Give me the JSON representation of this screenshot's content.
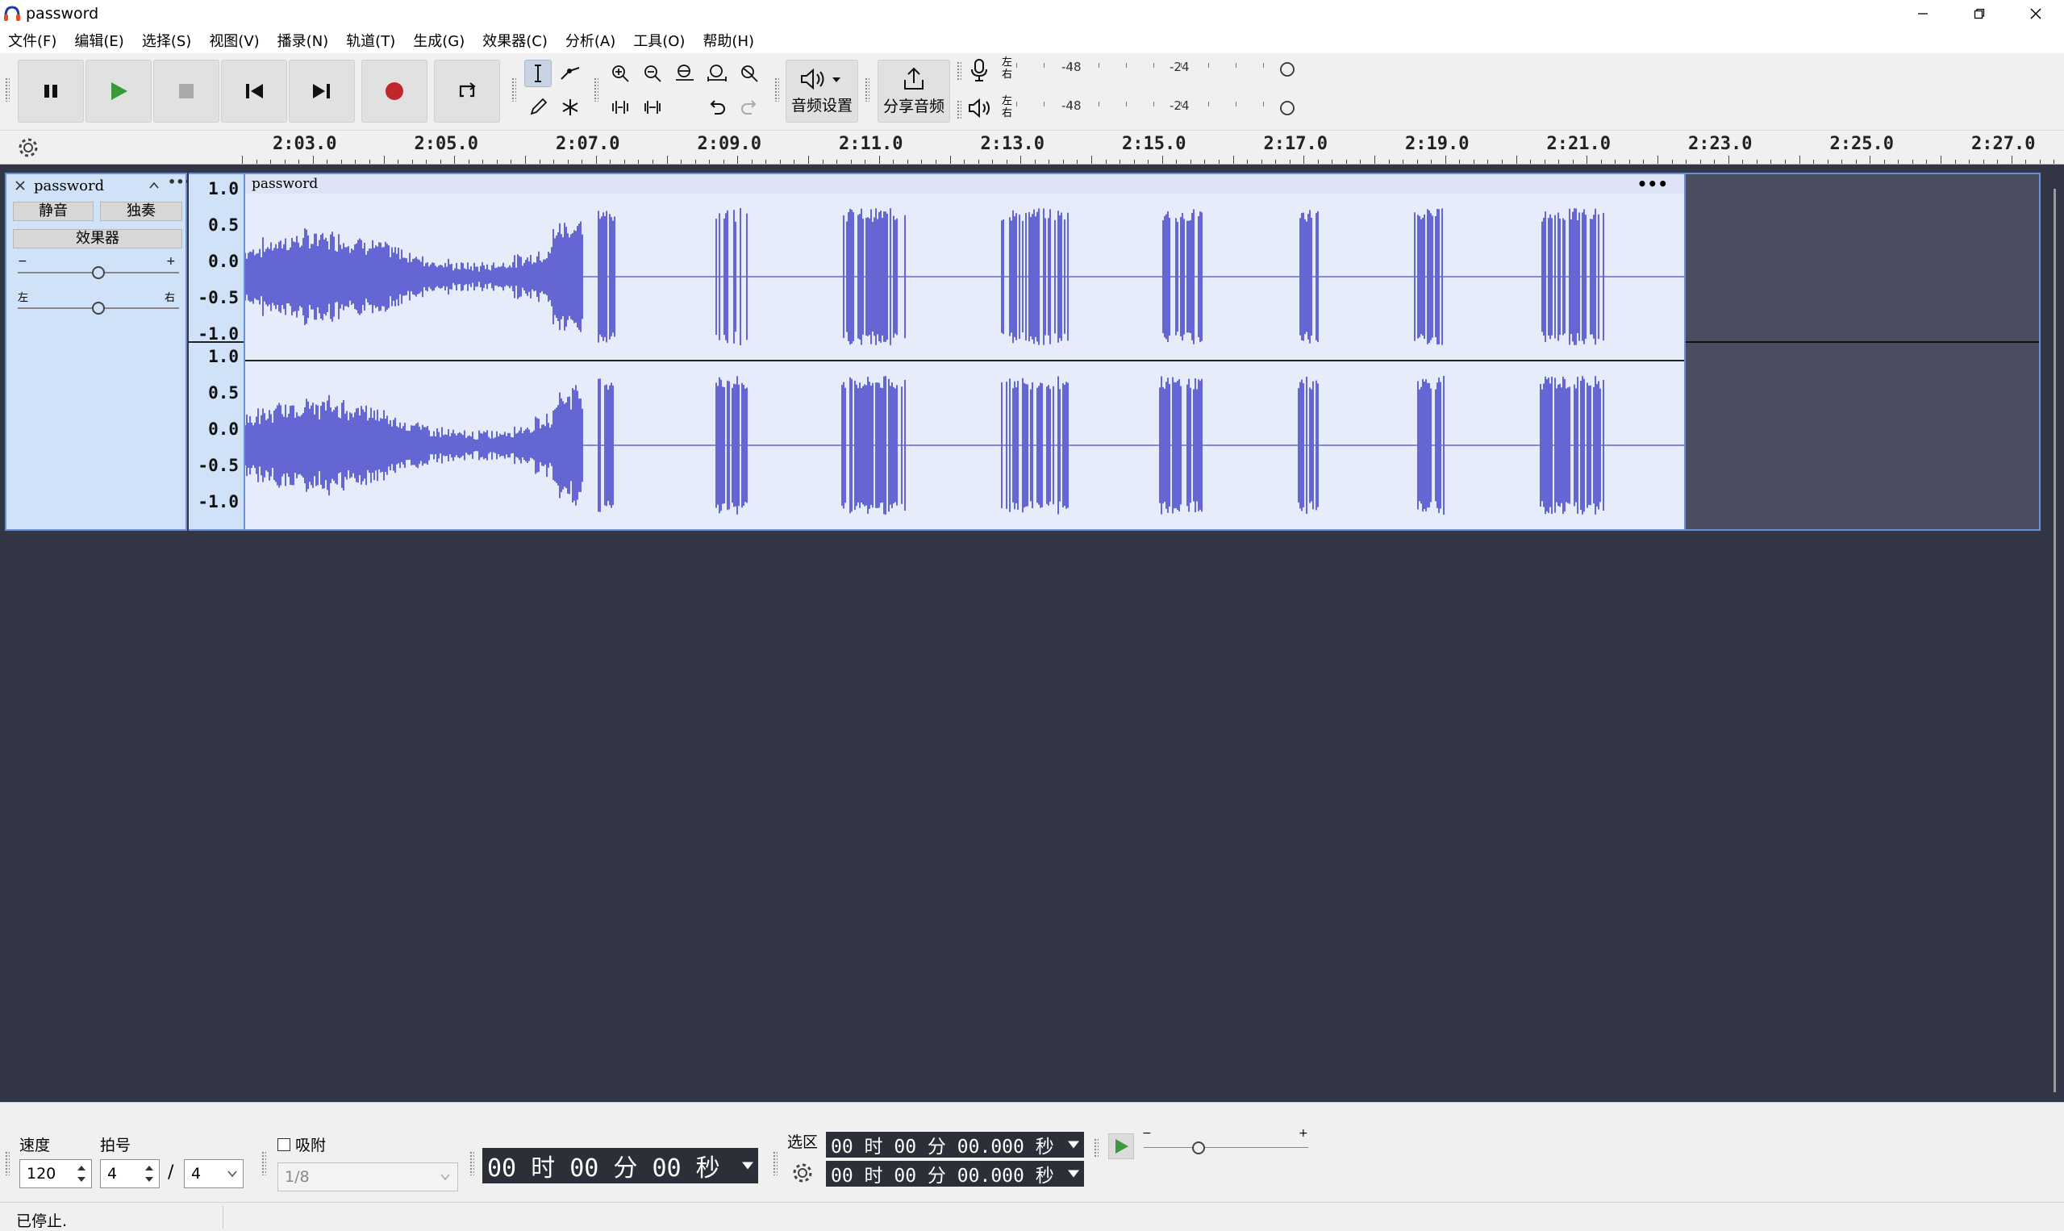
{
  "window": {
    "title": "password"
  },
  "menu": [
    "文件(F)",
    "编辑(E)",
    "选择(S)",
    "视图(V)",
    "播录(N)",
    "轨道(T)",
    "生成(G)",
    "效果器(C)",
    "分析(A)",
    "工具(O)",
    "帮助(H)"
  ],
  "toolbar": {
    "audio_settings_label": "音频设置",
    "share_audio_label": "分享音频",
    "meter_left_right": "左右",
    "meter_ticks": [
      "-48",
      "-24"
    ]
  },
  "ruler": {
    "labels": [
      "2:03.0",
      "2:05.0",
      "2:07.0",
      "2:09.0",
      "2:11.0",
      "2:13.0",
      "2:15.0",
      "2:17.0",
      "2:19.0",
      "2:21.0",
      "2:23.0",
      "2:25.0",
      "2:27.0"
    ]
  },
  "track": {
    "name": "password",
    "mute_label": "静音",
    "solo_label": "独奏",
    "effects_label": "效果器",
    "gain_minus": "−",
    "gain_plus": "+",
    "pan_left": "左",
    "pan_right": "右",
    "clip_title": "password",
    "clip_menu": "•••",
    "scale_labels": [
      "1.0",
      "0.5",
      "0.0",
      "-0.5",
      "-1.0"
    ]
  },
  "bottom": {
    "tempo_label": "速度",
    "tempo_value": "120",
    "time_sig_label": "拍号",
    "time_sig_top": "4",
    "time_sig_slash": "/",
    "time_sig_bottom": "4",
    "snap_label": "吸附",
    "snap_value": "1/8",
    "time_display": "00 时 00 分 00 秒",
    "selection_label": "选区",
    "selection_start": "00 时 00 分 00.000 秒",
    "selection_end": "00 时 00 分 00.000 秒",
    "speed_minus": "−",
    "speed_plus": "+"
  },
  "status": {
    "text": "已停止."
  },
  "colors": {
    "waveform": "#6466d4",
    "track_bg": "#e6ecf9",
    "dark_bg": "#323546",
    "record": "#c0272d",
    "play": "#3a9a3a"
  }
}
